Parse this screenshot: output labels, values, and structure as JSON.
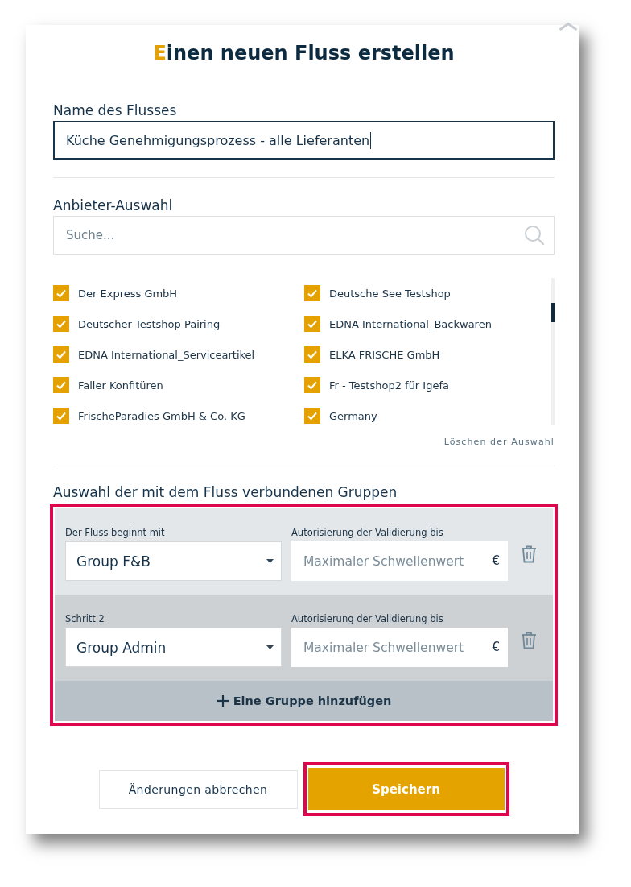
{
  "dialog": {
    "title": "Einen neuen Fluss erstellen"
  },
  "name_field": {
    "label": "Name des Flusses",
    "value": "Küche Genehmigungsprozess - alle Lieferanten",
    "focused": true
  },
  "supplier_selection": {
    "label": "Anbieter-Auswahl",
    "search": {
      "placeholder": "Suche..."
    },
    "suppliers": [
      {
        "name": "Der Express GmbH",
        "checked": true
      },
      {
        "name": "Deutsche See Testshop",
        "checked": true
      },
      {
        "name": "Deutscher Testshop Pairing",
        "checked": true
      },
      {
        "name": "EDNA International_Backwaren",
        "checked": true
      },
      {
        "name": "EDNA International_Serviceartikel",
        "checked": true
      },
      {
        "name": "ELKA FRISCHE GmbH",
        "checked": true
      },
      {
        "name": "Faller Konfitüren",
        "checked": true
      },
      {
        "name": "Fr - Testshop2 für Igefa",
        "checked": true
      },
      {
        "name": "FrischeParadies GmbH & Co. KG",
        "checked": true
      },
      {
        "name": "Germany",
        "checked": true
      }
    ],
    "clear_link": "Löschen der Auswahl"
  },
  "groups": {
    "label": "Auswahl der mit dem Fluss verbundenen Gruppen",
    "highlighted": true,
    "steps": [
      {
        "label": "Der Fluss beginnt mit",
        "group": "Group F&B",
        "threshold_label": "Autorisierung der Validierung bis",
        "threshold_placeholder": "Maximaler Schwellenwert",
        "currency": "€"
      },
      {
        "label": "Schritt 2",
        "group": "Group Admin",
        "threshold_label": "Autorisierung der Validierung bis",
        "threshold_placeholder": "Maximaler Schwellenwert",
        "currency": "€"
      }
    ],
    "add_button": "Eine Gruppe hinzufügen"
  },
  "actions": {
    "cancel": "Änderungen abbrechen",
    "save": {
      "label": "Speichern",
      "highlighted": true
    }
  }
}
